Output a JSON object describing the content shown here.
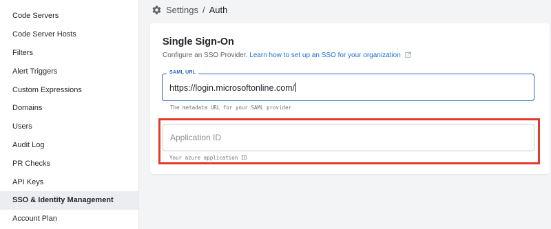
{
  "sidebar": {
    "items": [
      {
        "label": "Code Servers"
      },
      {
        "label": "Code Server Hosts"
      },
      {
        "label": "Filters"
      },
      {
        "label": "Alert Triggers"
      },
      {
        "label": "Custom Expressions"
      },
      {
        "label": "Domains"
      },
      {
        "label": "Users"
      },
      {
        "label": "Audit Log"
      },
      {
        "label": "PR Checks"
      },
      {
        "label": "API Keys"
      },
      {
        "label": "SSO & Identity Management"
      },
      {
        "label": "Account Plan"
      }
    ],
    "active_index": 10
  },
  "breadcrumb": {
    "icon": "gear-icon",
    "root": "Settings",
    "separator": "/",
    "current": "Auth"
  },
  "sso": {
    "title": "Single Sign-On",
    "subtitle": "Configure an SSO Provider.",
    "link_text": "Learn how to set up an SSO for your organization",
    "saml_url": {
      "label": "SAML URL",
      "value": "https://login.microsoftonline.com/",
      "helper": "The metadata URL for your SAML provider"
    },
    "application_id": {
      "placeholder": "Application ID",
      "value": "",
      "helper": "Your azure application ID"
    }
  },
  "colors": {
    "accent": "#2b63b8",
    "link": "#1f6fd1",
    "highlight": "#e03a2a",
    "sidebar_active_bg": "#ebedf0"
  }
}
